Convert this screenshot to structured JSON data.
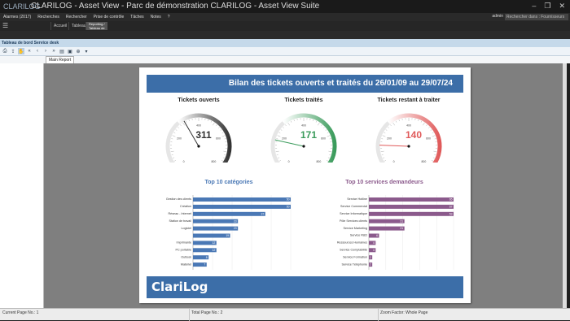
{
  "window": {
    "logo": "CLARILOG",
    "title": "CLARILOG - Asset View - Parc de démonstration CLARILOG - Asset View Suite",
    "controls": [
      "–",
      "❐",
      "✕"
    ]
  },
  "menubar": {
    "items": [
      "Alarmes (2017)",
      "Recherches",
      "Rechercher",
      "Prise de contrôle",
      "Tâches",
      "Notes"
    ],
    "help": "?",
    "user": "admin",
    "search_placeholder": "Rechercher dans : Fournisseurs"
  },
  "ribbon": {
    "tabs": [
      "Accueil",
      "Tableaux",
      "Reporting / Tableau de bord"
    ],
    "active_index": 2
  },
  "panel": {
    "title": "Tableau de bord Service desk"
  },
  "toolbar": {
    "buttons": [
      "print-icon",
      "export-icon",
      "hand-icon",
      "first-page-icon",
      "prev-page-icon",
      "next-page-icon",
      "last-page-icon",
      "page-setup-icon",
      "print-preview-icon",
      "zoom-icon",
      "dropdown-icon"
    ]
  },
  "report_tab": "Main Report",
  "report": {
    "title": "Bilan des tickets ouverts et traités du 26/01/09 au 29/07/24",
    "footer_logo": "ClariLog",
    "colors": {
      "banner": "#3c6ea8",
      "open": "#333333",
      "treated": "#3a9b5b",
      "remaining": "#e05a5a",
      "cat_bar": "#4a78b5",
      "svc_bar": "#8b5a8c"
    }
  },
  "gauges": [
    {
      "title": "Tickets ouverts",
      "value": "311",
      "color": "#333333",
      "max": 800,
      "fill": 311,
      "ticks": [
        "0",
        "100",
        "200",
        "300",
        "400",
        "500",
        "600",
        "700",
        "800"
      ]
    },
    {
      "title": "Tickets traités",
      "value": "171",
      "color": "#3a9b5b",
      "max": 800,
      "fill": 171,
      "ticks": [
        "0",
        "100",
        "200",
        "300",
        "400",
        "500",
        "600",
        "700",
        "800"
      ]
    },
    {
      "title": "Tickets restant à traiter",
      "value": "140",
      "color": "#e05a5a",
      "max": 800,
      "fill": 140,
      "ticks": [
        "0",
        "100",
        "200",
        "300",
        "400",
        "500",
        "600",
        "700",
        "800"
      ]
    }
  ],
  "chart_data": [
    {
      "type": "bar",
      "title": "Top 10 catégories",
      "categories": [
        "Gestion des clients",
        "Création",
        "Réseau - Internet",
        "Station de travail",
        "Logiciel",
        "",
        "Imprimante",
        "PC portable",
        "Outlook",
        "Matériel"
      ],
      "values": [
        50,
        50,
        37,
        23,
        23,
        19,
        12,
        12,
        8,
        7
      ],
      "xlim": [
        0,
        50
      ],
      "xticks": [
        "0",
        "10",
        "20",
        "30",
        "40",
        "50"
      ],
      "color": "#4a78b5"
    },
    {
      "type": "bar",
      "title": "Top 10 services demandeurs",
      "categories": [
        "Service Hotline",
        "Service Commercial",
        "Service Informatique",
        "Pôle  Services clients",
        "Service Marketing",
        "Service R&D",
        "Ressources Humaines",
        "Service Comptabilité",
        "Service Formation",
        "Service Téléphonie"
      ],
      "values": [
        65,
        67,
        53,
        21,
        21,
        6,
        4,
        4,
        2,
        2
      ],
      "xlim": [
        0,
        50
      ],
      "xticks": [
        "0",
        "10",
        "20",
        "30",
        "40",
        "50"
      ],
      "color": "#8b5a8c"
    }
  ],
  "status": {
    "current_page": "Current Page No.: 1",
    "total_page": "Total Page No.: 2",
    "zoom": "Zoom Factor: Whole Page"
  }
}
